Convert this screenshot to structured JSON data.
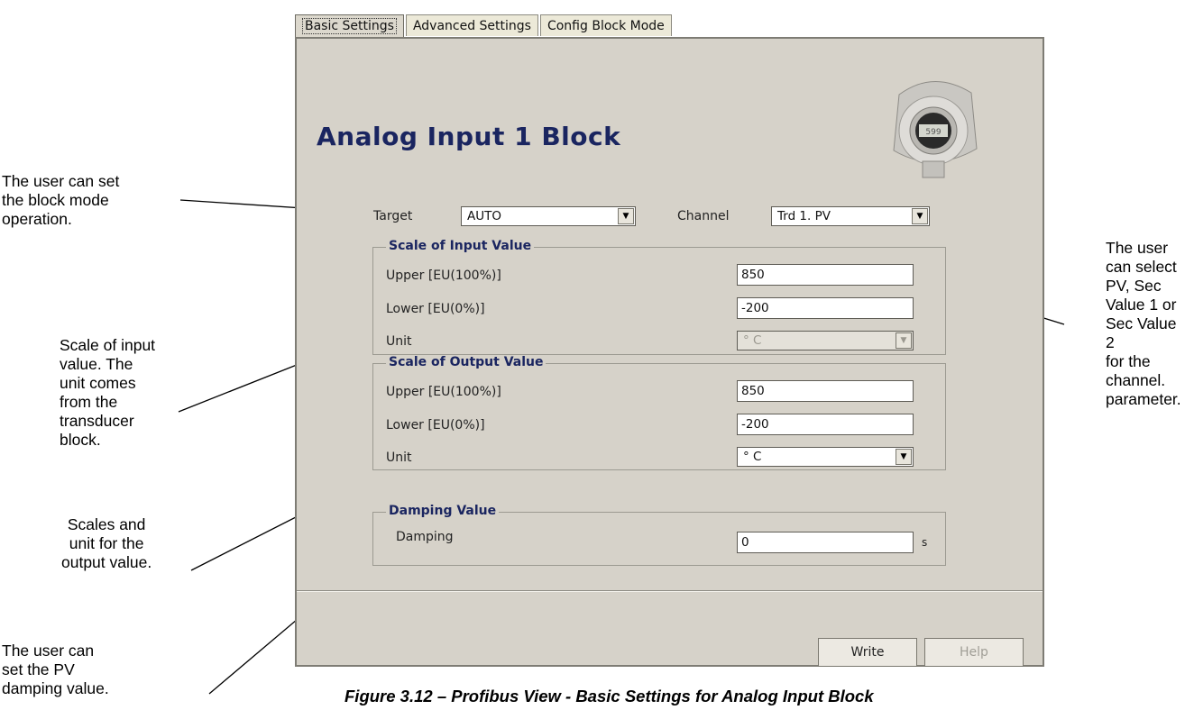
{
  "tabs": [
    "Basic Settings",
    "Advanced Settings",
    "Config Block Mode"
  ],
  "block_title": "Analog Input 1 Block",
  "device_display": "599",
  "target": {
    "label": "Target",
    "value": "AUTO"
  },
  "channel": {
    "label": "Channel",
    "value": "Trd 1. PV"
  },
  "input_scale": {
    "title": "Scale of Input Value",
    "upper_label": "Upper [EU(100%)]",
    "upper_value": "850",
    "lower_label": "Lower [EU(0%)]",
    "lower_value": "-200",
    "unit_label": "Unit",
    "unit_value": "° C"
  },
  "output_scale": {
    "title": "Scale of Output Value",
    "upper_label": "Upper [EU(100%)]",
    "upper_value": "850",
    "lower_label": "Lower [EU(0%)]",
    "lower_value": "-200",
    "unit_label": "Unit",
    "unit_value": "° C"
  },
  "damping": {
    "title": "Damping Value",
    "label": "Damping",
    "value": "0",
    "unit": "s"
  },
  "buttons": {
    "write": "Write",
    "help": "Help"
  },
  "annotations": {
    "target": "The user can set\nthe block mode\noperation.",
    "channel": "The user\ncan select\nPV, Sec\nValue 1 or\nSec Value 2\nfor the\nchannel.\nparameter.",
    "input_scale": "Scale of input\nvalue. The\nunit comes\nfrom the\ntransducer\nblock.",
    "output_scale": "Scales and\nunit for the\noutput value.",
    "damping": "The user can\nset the PV\ndamping value."
  },
  "caption": "Figure 3.12 – Profibus View - Basic Settings for Analog Input Block"
}
